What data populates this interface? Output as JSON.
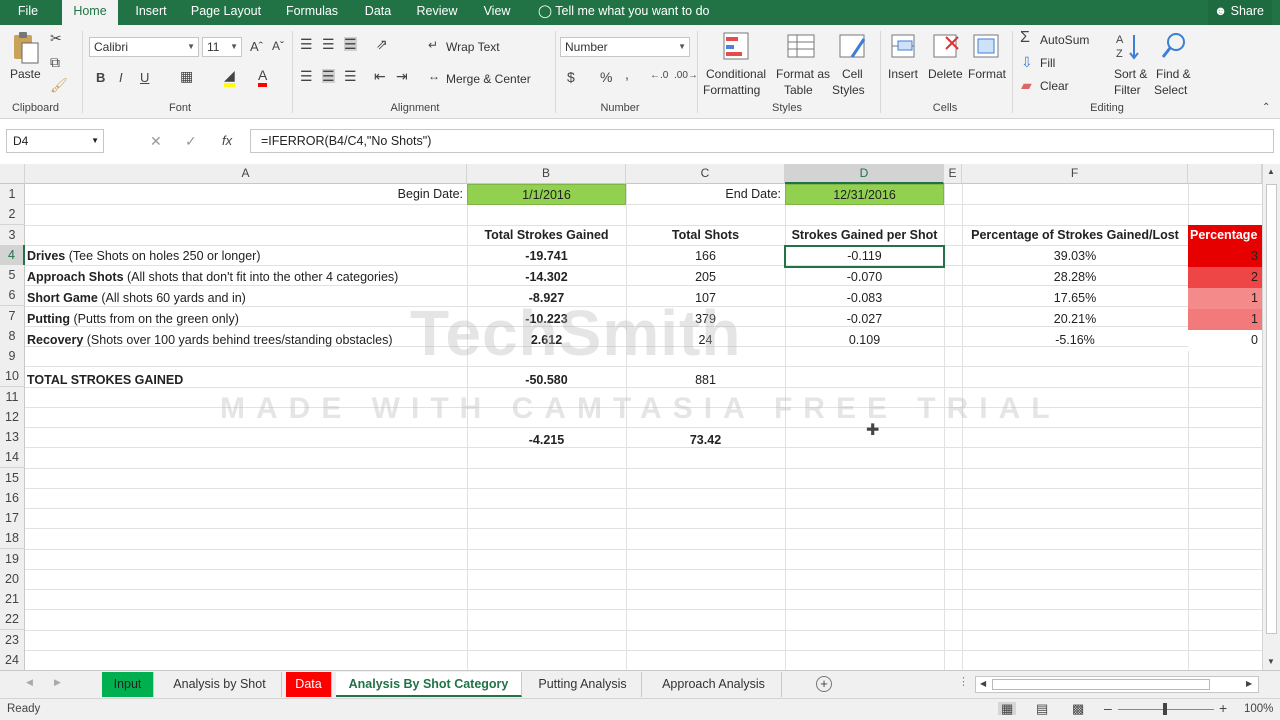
{
  "ribbon_tabs": [
    "File",
    "Home",
    "Insert",
    "Page Layout",
    "Formulas",
    "Data",
    "Review",
    "View"
  ],
  "active_tab": "Home",
  "tell_me": "Tell me what you want to do",
  "share": "Share",
  "clipboard": {
    "paste": "Paste",
    "group": "Clipboard"
  },
  "font": {
    "name": "Calibri",
    "size": "11",
    "group": "Font"
  },
  "alignment": {
    "wrap_text": "Wrap Text",
    "merge_center": "Merge & Center",
    "group": "Alignment"
  },
  "number": {
    "format": "Number",
    "currency": "$",
    "percent": "%",
    "comma": ",",
    "group": "Number"
  },
  "styles": {
    "conditional_1": "Conditional",
    "conditional_2": "Formatting",
    "format_table_1": "Format as",
    "format_table_2": "Table",
    "cell_styles_1": "Cell",
    "cell_styles_2": "Styles",
    "group": "Styles"
  },
  "cells": {
    "insert": "Insert",
    "delete": "Delete",
    "format": "Format",
    "group": "Cells"
  },
  "editing": {
    "autosum": "AutoSum",
    "fill": "Fill",
    "clear": "Clear",
    "sort_1": "Sort &",
    "sort_2": "Filter",
    "find_1": "Find &",
    "find_2": "Select",
    "group": "Editing"
  },
  "formula_bar": {
    "name_box": "D4",
    "fx": "fx",
    "formula": "=IFERROR(B4/C4,\"No Shots\")"
  },
  "columns": [
    "A",
    "B",
    "C",
    "D",
    "E",
    "F"
  ],
  "rows": [
    "1",
    "2",
    "3",
    "4",
    "5",
    "6",
    "7",
    "8",
    "9",
    "10",
    "11",
    "12",
    "13",
    "14",
    "15",
    "16",
    "17",
    "18",
    "19",
    "20",
    "21",
    "22",
    "23",
    "24"
  ],
  "sheet": {
    "begin_date_label": "Begin Date:",
    "begin_date": "1/1/2016",
    "end_date_label": "End Date:",
    "end_date": "12/31/2016",
    "headers": {
      "b": "Total Strokes Gained",
      "c": "Total Shots",
      "d": "Strokes Gained per Shot",
      "f": "Percentage of Strokes Gained/Lost",
      "g": "Percentage"
    },
    "categories": [
      {
        "name": "Drives",
        "desc": " (Tee Shots on holes 250 or longer)",
        "b": "-19.741",
        "c": "166",
        "d": "-0.119",
        "f": "39.03%",
        "g": "3",
        "color": "#e60000"
      },
      {
        "name": "Approach Shots",
        "desc": " (All shots that don't fit into the other 4 categories)",
        "b": "-14.302",
        "c": "205",
        "d": "-0.070",
        "f": "28.28%",
        "g": "2",
        "color": "#ee4646"
      },
      {
        "name": "Short Game",
        "desc": " (All shots 60 yards and in)",
        "b": "-8.927",
        "c": "107",
        "d": "-0.083",
        "f": "17.65%",
        "g": "1",
        "color": "#f48a8a"
      },
      {
        "name": "Putting",
        "desc": " (Putts from on the green only)",
        "b": "-10.223",
        "c": "379",
        "d": "-0.027",
        "f": "20.21%",
        "g": "1",
        "color": "#f27a7a"
      },
      {
        "name": "Recovery",
        "desc": " (Shots over 100 yards behind trees/standing obstacles)",
        "b": "2.612",
        "c": "24",
        "d": "0.109",
        "f": "-5.16%",
        "g": "0",
        "color": "#ffffff"
      }
    ],
    "total_label": "TOTAL STROKES GAINED",
    "total_b": "-50.580",
    "total_c": "881",
    "row13_b": "-4.215",
    "row13_c": "73.42"
  },
  "sheet_tabs": [
    {
      "label": "Input",
      "color": "#00b050"
    },
    {
      "label": "Analysis by Shot",
      "color": ""
    },
    {
      "label": "Data",
      "color": "#ff0000"
    },
    {
      "label": "Analysis By Shot Category",
      "color": ""
    },
    {
      "label": "Putting Analysis",
      "color": ""
    },
    {
      "label": "Approach Analysis",
      "color": ""
    }
  ],
  "active_sheet": "Analysis By Shot Category",
  "status": {
    "ready": "Ready",
    "zoom": "100%"
  },
  "watermark": {
    "line1": "TechSmith",
    "line2": "MADE WITH CAMTASIA FREE TRIAL"
  }
}
